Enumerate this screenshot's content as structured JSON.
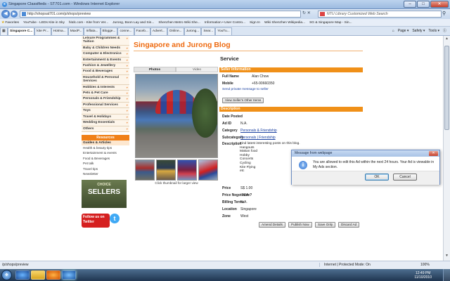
{
  "window": {
    "title": "Singapore Classifieds - ST701.com - Windows Internet Explorer"
  },
  "address": {
    "url": "http://shopsat701.com/p/shops/preview",
    "search_placeholder": "NTU Library Customized Web Search"
  },
  "favorites": [
    "Favorites",
    "YouTube - LEDs Kite in Sky",
    "hitdc.com - Kite from Ver...",
    "Jurong, Boon Lay and Sin...",
    "Shenzhen Metro Wiki She...",
    "Information • User Contro...",
    "Sign In",
    "Wiki Shenzhen Wikipedia...",
    "SG & Singapore Map - Sin..."
  ],
  "tabs": [
    "Singapore C...",
    "kite Pr...",
    "Hotma...",
    "MaxiP...",
    "Inflata...",
    "Blogge...",
    "conne...",
    "Faceb...",
    "Advert...",
    "Online...",
    "Jurong...",
    "Sear...",
    "YouTu..."
  ],
  "commands": [
    "Page ▾",
    "Safety ▾",
    "Tools ▾",
    "Ⓘ"
  ],
  "sidebar": {
    "categories": [
      "Leisure Programmes & Tuition",
      "Baby & Children Needs",
      "Computer & Electronics",
      "Entertainment & Events",
      "Fashion & Jewellery",
      "Food & Beverages",
      "Household & Personal Services",
      "Hobbies & Interests",
      "Pets & Pet Care",
      "Personals & Friendship",
      "Professional Services",
      "Toys",
      "Travel & Holidays",
      "Wedding Essentials",
      "Others"
    ],
    "resources_title": "Resources",
    "guides_title": "Guides & Articles",
    "guides": [
      "Health & beauty tips",
      "Entertainment & events",
      "Food & Beverages",
      "Pet talk",
      "Travel tips",
      "Newsletter"
    ],
    "choice_top": "CHOICE",
    "choice_bottom": "SELLERS",
    "follow_label": "Follow us on",
    "twitter_label": "Twitter"
  },
  "main": {
    "heading": "Singapore and Jurong Blog",
    "photo_tab": "Photos",
    "video_tab": "Video",
    "thumb_caption": "Click thumbnail for larger view",
    "service": "Service",
    "seller_header": "Seller Information",
    "fullname_label": "Full Name",
    "fullname": "Alan Chow",
    "mobile_label": "Mobile",
    "mobile": "+65-90660350",
    "send_link": "Send private message to seller",
    "view_items_btn": "View Seller's Other Items",
    "desc_header": "Description",
    "date_label": "Date Posted",
    "date": "",
    "adid_label": "Ad ID",
    "adid": "N.A.",
    "category_label": "Category",
    "category": "Personals & Friendship",
    "subcategory_label": "Subcategory",
    "subcategory": "Personals | Friendship",
    "description_label": "Description",
    "description": "Find latest interesting posts on this blog.\nHangouts\nMakan food\nHobby\nConcerts\nCycling\nKite Flying\netc",
    "price_label": "Price",
    "price": "S$ 1.00",
    "negotiable_label": "Price Negotiable?",
    "negotiable": "N.A.",
    "billing_label": "Billing Terms",
    "billing": "N.A.",
    "location_label": "Location",
    "location": "Singapore",
    "zone_label": "Zone",
    "zone": "West",
    "buttons": [
      "Amend Details",
      "Publish Now",
      "Save Only",
      "Discard Ad"
    ]
  },
  "dialog": {
    "title": "Message from webpage",
    "message": "You are allowed to edit this Ad within the next 24 hours. Your Ad is viewable in My Ads section.",
    "ok": "OK",
    "cancel": "Cancel"
  },
  "status": {
    "url": "/p/shops/preview",
    "zone": "Internet | Protected Mode: On",
    "zoom": "100%"
  },
  "taskbar": {
    "time": "12:49 PM",
    "date": "11/10/2010"
  }
}
